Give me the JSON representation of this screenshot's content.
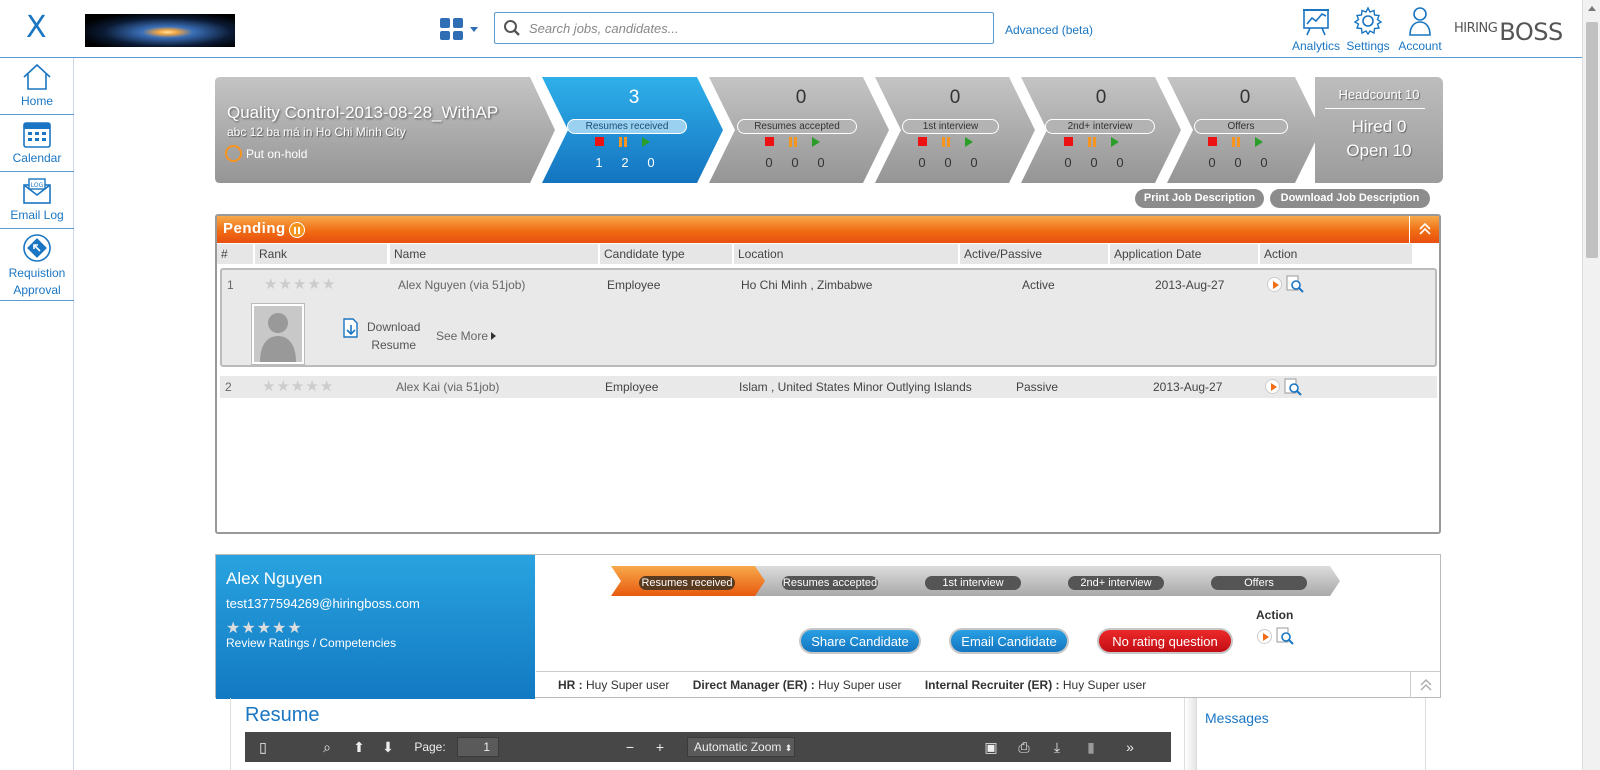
{
  "header": {
    "brand_x": "X",
    "search_placeholder": "Search jobs, candidates...",
    "advanced_link": "Advanced (beta)",
    "nav": [
      {
        "label": "Analytics",
        "icon": "analytics-icon"
      },
      {
        "label": "Settings",
        "icon": "gear-icon"
      },
      {
        "label": "Account",
        "icon": "user-icon"
      }
    ],
    "logo_small": "HIRING",
    "logo_big": "BOSS"
  },
  "sidebar": {
    "items": [
      {
        "label": "Home",
        "icon": "home-icon"
      },
      {
        "label": "Calendar",
        "icon": "calendar-icon"
      },
      {
        "label": "Email Log",
        "icon": "email-log-icon"
      },
      {
        "label": "Requistion Approval",
        "icon": "requisition-approval-icon"
      }
    ]
  },
  "job": {
    "title": "Quality Control-2013-08-28_WithAP",
    "subtitle": "abc 12 ba má in Ho Chi Minh City",
    "hold_label": "Put on-hold"
  },
  "stages": [
    {
      "label": "Resumes received",
      "count": "3",
      "stop": "1",
      "pause": "2",
      "play": "0",
      "active": true
    },
    {
      "label": "Resumes accepted",
      "count": "0",
      "stop": "0",
      "pause": "0",
      "play": "0",
      "active": false
    },
    {
      "label": "1st interview",
      "count": "0",
      "stop": "0",
      "pause": "0",
      "play": "0",
      "active": false
    },
    {
      "label": "2nd+ interview",
      "count": "0",
      "stop": "0",
      "pause": "0",
      "play": "0",
      "active": false
    },
    {
      "label": "Offers",
      "count": "0",
      "stop": "0",
      "pause": "0",
      "play": "0",
      "active": false
    }
  ],
  "headcount": {
    "title": "Headcount 10",
    "hired": "Hired 0",
    "open": "Open 10"
  },
  "job_buttons": {
    "print": "Print Job Description",
    "download": "Download Job Description"
  },
  "pending": {
    "title": "Pending",
    "columns": [
      "#",
      "Rank",
      "Name",
      "Candidate type",
      "Location",
      "Active/Passive",
      "Application Date",
      "Action"
    ],
    "rows": [
      {
        "num": "1",
        "name": "Alex Nguyen",
        "via": "(via 51job)",
        "type": "Employee",
        "location": "Ho Chi Minh , Zimbabwe",
        "status": "Active",
        "date": "2013-Aug-27",
        "rating": 0
      },
      {
        "num": "2",
        "name": "Alex Kai",
        "via": "(via 51job)",
        "type": "Employee",
        "location": "Islam , United States Minor Outlying Islands",
        "status": "Passive",
        "date": "2013-Aug-27",
        "rating": 0
      }
    ],
    "download_resume_1": "Download",
    "download_resume_2": "Resume",
    "see_more": "See More"
  },
  "candidate": {
    "name": "Alex Nguyen",
    "email": "test1377594269@hiringboss.com",
    "rating": 0,
    "review_link": "Review Ratings / Competencies",
    "mini_stages": [
      "Resumes received",
      "Resumes accepted",
      "1st interview",
      "2nd+ interview",
      "Offers"
    ],
    "share_button": "Share Candidate",
    "email_button": "Email Candidate",
    "rating_button": "No rating question",
    "action_label": "Action",
    "hr_label": "HR :",
    "hr_value": "Huy Super user",
    "dm_label": "Direct Manager (ER) :",
    "dm_value": "Huy Super user",
    "ir_label": "Internal Recruiter (ER) :",
    "ir_value": "Huy Super user"
  },
  "resume": {
    "title": "Resume",
    "page_label": "Page:",
    "page_value": "1",
    "zoom": "Automatic Zoom"
  },
  "messages": {
    "title": "Messages"
  },
  "colors": {
    "accent": "#1a76c2",
    "pending_orange": "#f06d14",
    "share_blue": "#1a8bd6",
    "rating_red": "#d9131b"
  }
}
